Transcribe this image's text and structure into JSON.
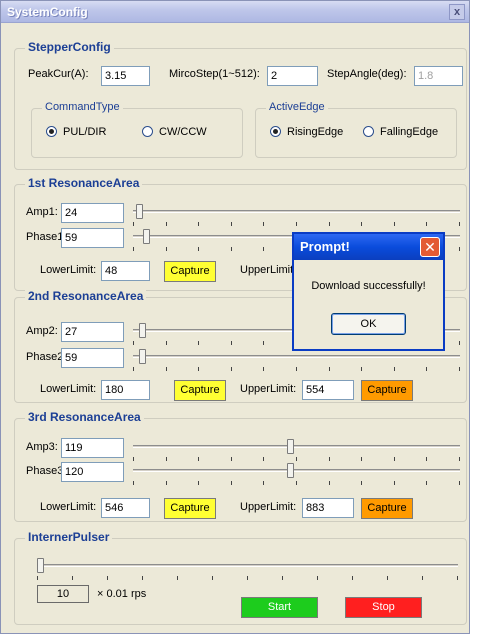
{
  "window": {
    "title": "SystemConfig",
    "close_glyph": "x"
  },
  "stepper": {
    "legend": "StepperConfig",
    "peak_label": "PeakCur(A):",
    "peak_value": "3.15",
    "micro_label": "MircoStep(1~512):",
    "micro_value": "2",
    "angle_label": "StepAngle(deg):",
    "angle_value": "1.8",
    "command_type": {
      "legend": "CommandType",
      "opt1": "PUL/DIR",
      "opt2": "CW/CCW",
      "selected": "PUL/DIR"
    },
    "active_edge": {
      "legend": "ActiveEdge",
      "opt1": "RisingEdge",
      "opt2": "FallingEdge",
      "selected": "RisingEdge"
    }
  },
  "res1": {
    "legend": "1st ResonanceArea",
    "amp_label": "Amp1:",
    "amp_value": "24",
    "phase_label": "Phase1:",
    "phase_value": "59",
    "lower_label": "LowerLimit:",
    "lower_value": "48",
    "capture_label": "Capture",
    "upper_label": "UpperLimit:",
    "upper_value": "",
    "amp_slider_level": 0.01,
    "phase_slider_level": 0.03
  },
  "res2": {
    "legend": "2nd ResonanceArea",
    "amp_label": "Amp2:",
    "amp_value": "27",
    "phase_label": "Phase2:",
    "phase_value": "59",
    "lower_label": "LowerLimit:",
    "lower_value": "180",
    "capture_label": "Capture",
    "upper_label": "UpperLimit:",
    "upper_value": "554",
    "capture2_label": "Capture",
    "amp_slider_level": 0.02,
    "phase_slider_level": 0.02
  },
  "res3": {
    "legend": "3rd ResonanceArea",
    "amp_label": "Amp3:",
    "amp_value": "119",
    "phase_label": "Phase3:",
    "phase_value": "120",
    "lower_label": "LowerLimit:",
    "lower_value": "546",
    "capture_label": "Capture",
    "upper_label": "UpperLimit:",
    "upper_value": "883",
    "capture2_label": "Capture",
    "amp_slider_level": 0.48,
    "phase_slider_level": 0.48
  },
  "pulser": {
    "legend": "InternerPulser",
    "counter_value": "10",
    "unit_label": "× 0.01 rps",
    "start_label": "Start",
    "stop_label": "Stop",
    "slider_level": 0.0
  },
  "prompt": {
    "title": "Prompt!",
    "message": "Download successfully!",
    "ok_label": "OK",
    "close_glyph": "✕"
  },
  "colors": {
    "capture_yellow": "#ffff33",
    "capture_orange": "#ff9a00",
    "start_green": "#1dcc1d",
    "stop_red": "#ff1f1f",
    "group_title_blue": "#1c3f95"
  }
}
